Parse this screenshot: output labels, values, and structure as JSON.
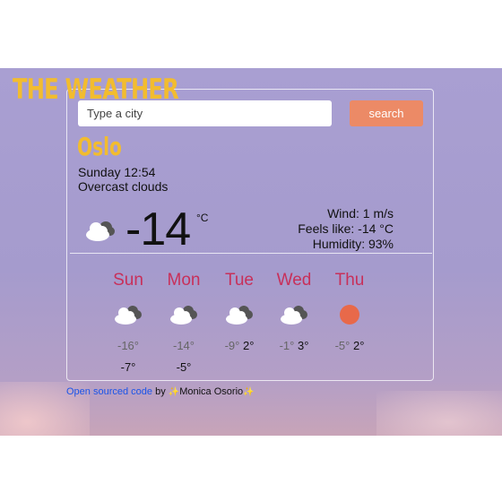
{
  "app": {
    "title": "THE WEATHER"
  },
  "search": {
    "placeholder": "Type a city",
    "button_label": "search"
  },
  "current": {
    "city": "Oslo",
    "date": "Sunday 12:54",
    "description": "Overcast clouds",
    "icon": "cloud-icon",
    "temperature": "-14",
    "unit": "°C",
    "wind": "Wind: 1 m/s",
    "feels_like": "Feels like: -14 °C",
    "humidity": "Humidity: 93%"
  },
  "forecast": [
    {
      "day": "Sun",
      "icon": "cloud-icon",
      "temp_a": "-16°",
      "temp_b": "",
      "temp_c": "-7°"
    },
    {
      "day": "Mon",
      "icon": "cloud-icon",
      "temp_a": "-14°",
      "temp_b": "",
      "temp_c": "-5°"
    },
    {
      "day": "Tue",
      "icon": "cloud-icon",
      "temp_a": "-9°",
      "temp_b": "2°",
      "temp_c": ""
    },
    {
      "day": "Wed",
      "icon": "cloud-icon",
      "temp_a": "-1°",
      "temp_b": "3°",
      "temp_c": ""
    },
    {
      "day": "Thu",
      "icon": "sun-icon",
      "temp_a": "-5°",
      "temp_b": "2°",
      "temp_c": ""
    }
  ],
  "footer": {
    "link_text": "Open sourced code",
    "by_text": "by",
    "author": "Monica Osorio",
    "sparkle": "✨"
  },
  "colors": {
    "accent_yellow": "#f2bc2f",
    "button_orange": "#ec8a66",
    "day_red": "#c8305a",
    "sun_orange": "#e8694a",
    "link_blue": "#1b54e8"
  }
}
